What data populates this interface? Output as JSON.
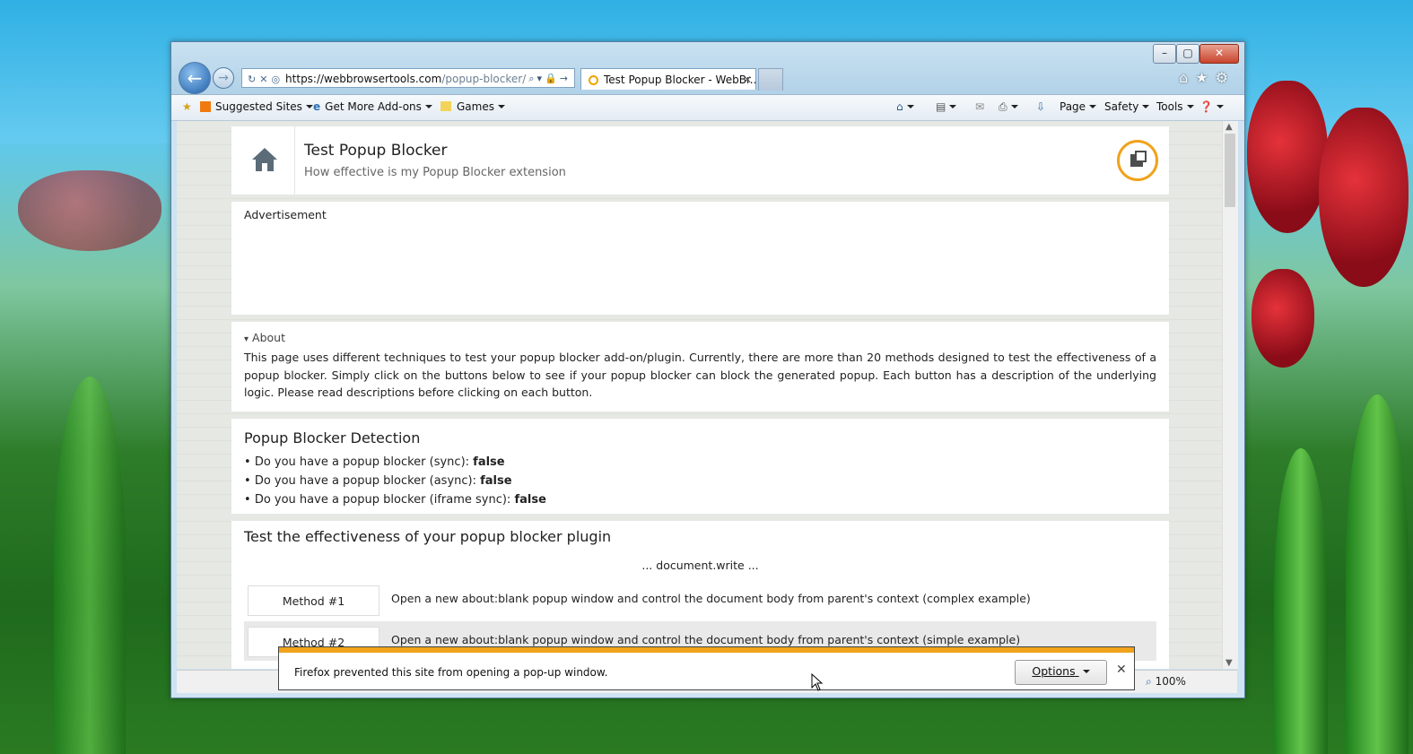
{
  "browser": {
    "url_host": "https://webbrowsertools.com",
    "url_path": "/popup-blocker/",
    "tab_title": "Test Popup Blocker - WebBr...",
    "zoom": "100%"
  },
  "favorites": {
    "suggested": "Suggested Sites",
    "addons": "Get More Add-ons",
    "games": "Games"
  },
  "commandbar": {
    "page": "Page",
    "safety": "Safety",
    "tools": "Tools"
  },
  "header": {
    "title": "Test Popup Blocker",
    "subtitle": "How effective is my Popup Blocker extension"
  },
  "ad": {
    "label": "Advertisement"
  },
  "about": {
    "heading": "About",
    "text": "This page uses different techniques to test your popup blocker add-on/plugin. Currently, there are more than 20 methods designed to test the effectiveness of a popup blocker. Simply click on the buttons below to see if your popup blocker can block the generated popup. Each button has a description of the underlying logic. Please read descriptions before clicking on each button."
  },
  "detection": {
    "title": "Popup Blocker Detection",
    "items": [
      {
        "label": "Do you have a popup blocker (sync):",
        "value": "false"
      },
      {
        "label": "Do you have a popup blocker (async):",
        "value": "false"
      },
      {
        "label": "Do you have a popup blocker (iframe sync):",
        "value": "false"
      }
    ]
  },
  "tests": {
    "title": "Test the effectiveness of your popup blocker plugin",
    "group": "... document.write ...",
    "methods": [
      {
        "label": "Method #1",
        "desc": "Open a new about:blank popup window and control the document body from parent's context (complex example)"
      },
      {
        "label": "Method #2",
        "desc": "Open a new about:blank popup window and control the document body from parent's context (simple example)"
      }
    ]
  },
  "notification": {
    "message": "Firefox prevented this site from opening a pop-up window.",
    "options": "Options"
  }
}
